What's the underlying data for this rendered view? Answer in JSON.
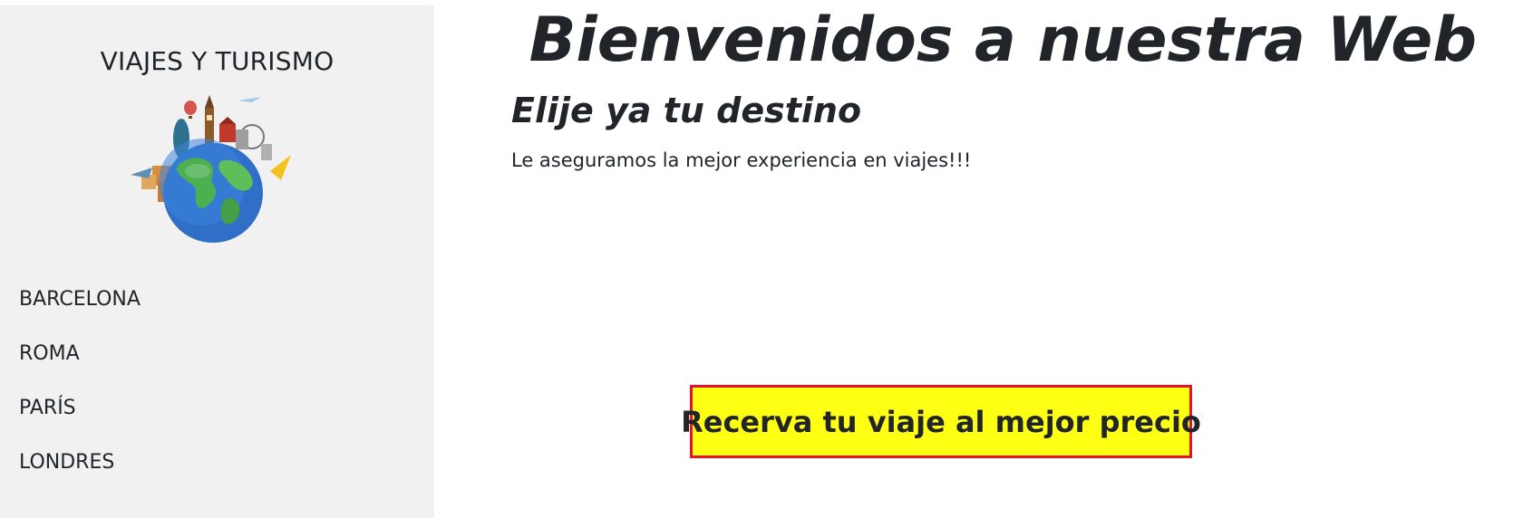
{
  "sidebar": {
    "brand": "VIAJES Y TURISMO",
    "logo": "globe-with-landmarks-logo",
    "items": [
      {
        "label": "BARCELONA"
      },
      {
        "label": "ROMA"
      },
      {
        "label": "PARÍS"
      },
      {
        "label": "LONDRES"
      }
    ]
  },
  "main": {
    "title": "Bienvenidos a nuestra Web",
    "subtitle": "Elije ya tu destino",
    "tagline": "Le aseguramos la mejor experiencia en viajes!!!",
    "cta_label": "Recerva tu viaje al mejor precio"
  },
  "colors": {
    "sidebar_bg": "#f1f1f1",
    "text": "#212529",
    "cta_bg": "#ffff14",
    "cta_border": "#e3152a"
  }
}
